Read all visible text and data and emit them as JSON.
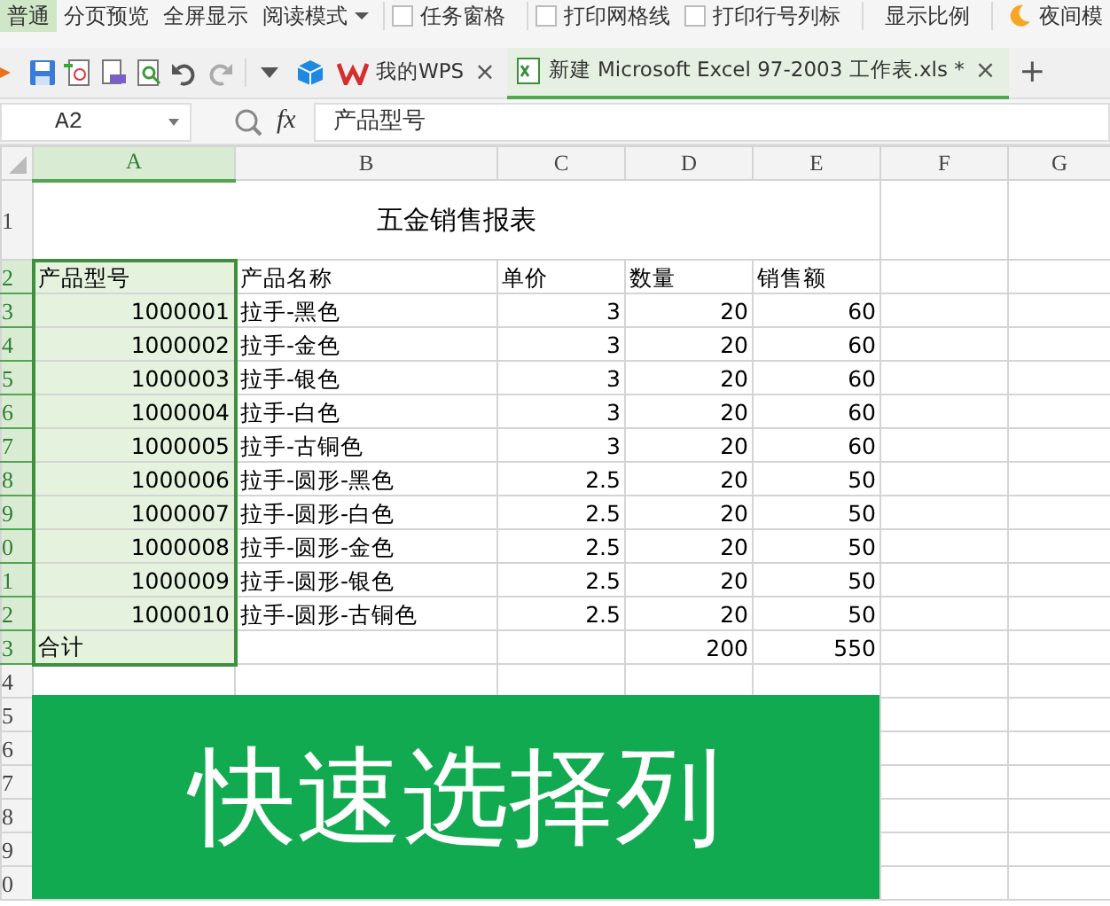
{
  "toolbar": {
    "views": [
      {
        "label": "普通",
        "selected": true
      },
      {
        "label": "分页预览",
        "selected": false
      },
      {
        "label": "全屏显示",
        "selected": false
      },
      {
        "label": "阅读模式",
        "selected": false
      }
    ],
    "options": [
      {
        "label": "任务窗格",
        "checked": false
      },
      {
        "label": "打印网格线",
        "checked": false
      },
      {
        "label": "打印行号列标",
        "checked": false
      }
    ],
    "zoom_label": "显示比例",
    "night_mode": "夜间模"
  },
  "tabs": [
    {
      "label": "我的WPS",
      "selected": false,
      "close": "×"
    },
    {
      "label": "新建 Microsoft Excel 97-2003 工作表.xls *",
      "selected": true,
      "close": "×"
    }
  ],
  "new_tab": "+",
  "formula_bar": {
    "name_box": "A2",
    "fx": "fx",
    "value": "产品型号"
  },
  "sheet": {
    "columns": [
      {
        "label": "A",
        "selected": true
      },
      {
        "label": "B",
        "selected": false
      },
      {
        "label": "C",
        "selected": false
      },
      {
        "label": "D",
        "selected": false
      },
      {
        "label": "E",
        "selected": false
      },
      {
        "label": "F",
        "selected": false
      },
      {
        "label": "G",
        "selected": false
      }
    ],
    "rows": [
      {
        "header": "1",
        "kind": "title",
        "selected": false,
        "title": "五金销售报表"
      },
      {
        "header": "2",
        "kind": "header",
        "selected": true,
        "cells": [
          "产品型号",
          "产品名称",
          "单价",
          "数量",
          "销售额"
        ]
      },
      {
        "header": "3",
        "kind": "data",
        "selected": true,
        "cells": [
          "1000001",
          "拉手-黑色",
          "3",
          "20",
          "60"
        ]
      },
      {
        "header": "4",
        "kind": "data",
        "selected": true,
        "cells": [
          "1000002",
          "拉手-金色",
          "3",
          "20",
          "60"
        ]
      },
      {
        "header": "5",
        "kind": "data",
        "selected": true,
        "cells": [
          "1000003",
          "拉手-银色",
          "3",
          "20",
          "60"
        ]
      },
      {
        "header": "6",
        "kind": "data",
        "selected": true,
        "cells": [
          "1000004",
          "拉手-白色",
          "3",
          "20",
          "60"
        ]
      },
      {
        "header": "7",
        "kind": "data",
        "selected": true,
        "cells": [
          "1000005",
          "拉手-古铜色",
          "3",
          "20",
          "60"
        ]
      },
      {
        "header": "8",
        "kind": "data",
        "selected": true,
        "cells": [
          "1000006",
          "拉手-圆形-黑色",
          "2.5",
          "20",
          "50"
        ]
      },
      {
        "header": "9",
        "kind": "data",
        "selected": true,
        "cells": [
          "1000007",
          "拉手-圆形-白色",
          "2.5",
          "20",
          "50"
        ]
      },
      {
        "header": "0",
        "kind": "data",
        "selected": true,
        "cells": [
          "1000008",
          "拉手-圆形-金色",
          "2.5",
          "20",
          "50"
        ]
      },
      {
        "header": "1",
        "kind": "data",
        "selected": true,
        "cells": [
          "1000009",
          "拉手-圆形-银色",
          "2.5",
          "20",
          "50"
        ]
      },
      {
        "header": "2",
        "kind": "data",
        "selected": true,
        "cells": [
          "1000010",
          "拉手-圆形-古铜色",
          "2.5",
          "20",
          "50"
        ]
      },
      {
        "header": "3",
        "kind": "total",
        "selected": true,
        "cells": [
          "合计",
          "",
          "",
          "200",
          "550"
        ]
      },
      {
        "header": "4",
        "kind": "empty",
        "selected": false,
        "cells": []
      },
      {
        "header": "5",
        "kind": "empty",
        "selected": false,
        "cells": []
      },
      {
        "header": "6",
        "kind": "empty",
        "selected": false,
        "cells": []
      },
      {
        "header": "7",
        "kind": "empty",
        "selected": false,
        "cells": []
      },
      {
        "header": "8",
        "kind": "empty",
        "selected": false,
        "cells": []
      },
      {
        "header": "9",
        "kind": "empty",
        "selected": false,
        "cells": []
      },
      {
        "header": "0",
        "kind": "empty",
        "selected": false,
        "cells": []
      }
    ]
  },
  "banner": {
    "text": "快速选择列"
  }
}
